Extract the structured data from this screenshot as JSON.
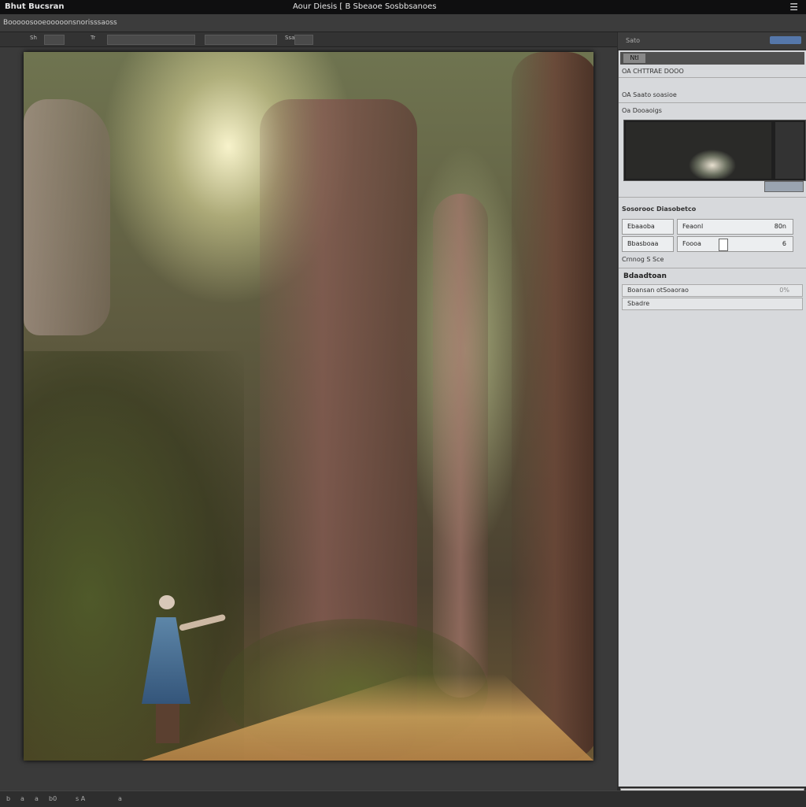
{
  "titlebar": {
    "app": "Bhut Bucsran",
    "document": "Aour Diesis [ B Sbeaoe Sosbbsanoes",
    "menu_icon": "hamburger-icon"
  },
  "menubar": {
    "path": "Booooosooeooooonsnorisssaoss"
  },
  "options": {
    "label1": "Sh",
    "label2": "Tr",
    "label3": "Ssa"
  },
  "panel": {
    "tab": "Sato",
    "nav_tab": "Ntl",
    "row1": "OA CHTTRAE DOOO",
    "row2": "OA Saato soasioe",
    "section_navigator": "Oa Dooaoigs",
    "section_properties": "Sosorooc Diasobetco",
    "field_left_1": "Ebaaoba",
    "field_right_1": "Feaonl",
    "field_right_1_val": "80n",
    "field_left_2": "Bbasboaa",
    "field_right_2": "Foooa",
    "field_right_2_val": "6",
    "row_change": "Crnnog S Sce",
    "section_adjust": "Bdaadtoan",
    "input1": "Boansan otSoaorao",
    "input1_pct": "0%",
    "input2": "Sbadre"
  },
  "status": {
    "s1": "b",
    "s2": "a",
    "s3": "a",
    "s4": "b0",
    "s5": "s A",
    "s6": "a"
  },
  "colors": {
    "accent": "#5577aa",
    "panel_bg": "#d7d9dc",
    "workspace": "#3a3a3a"
  }
}
